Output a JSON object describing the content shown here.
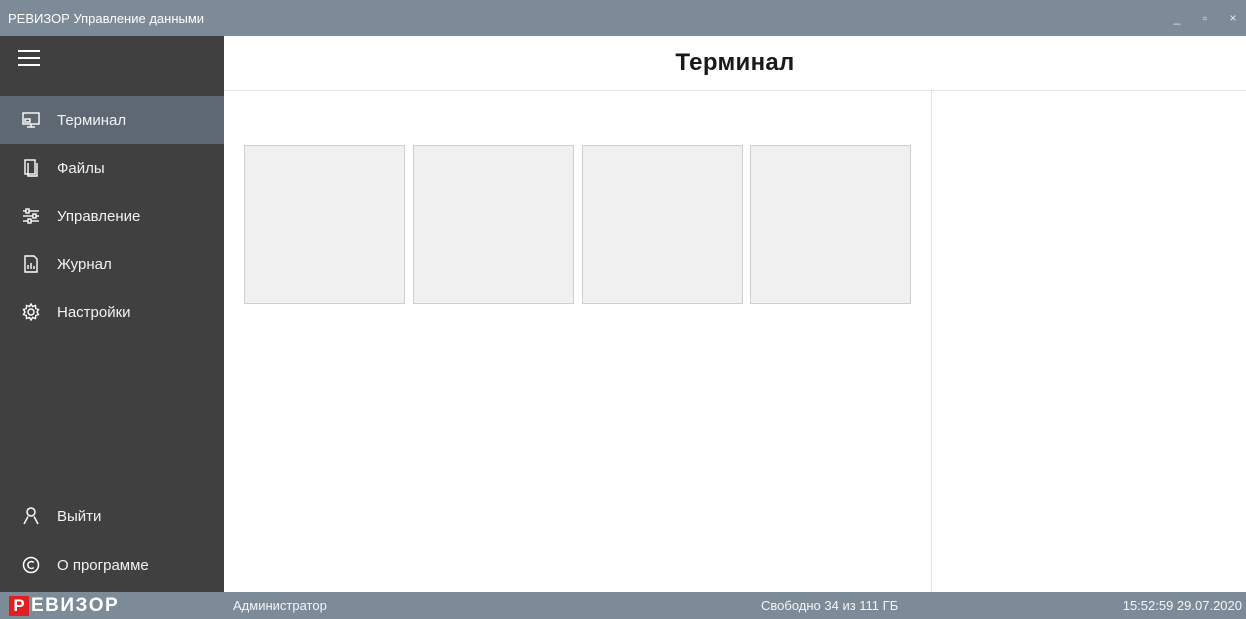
{
  "window": {
    "title": "РЕВИЗОР Управление данными",
    "controls": {
      "minimize": "_",
      "maximize": "▫",
      "close": "×"
    }
  },
  "sidebar": {
    "menu_icon": "hamburger-icon",
    "items": [
      {
        "label": "Терминал",
        "icon": "monitor-icon",
        "active": true
      },
      {
        "label": "Файлы",
        "icon": "files-icon",
        "active": false
      },
      {
        "label": "Управление",
        "icon": "sliders-icon",
        "active": false
      },
      {
        "label": "Журнал",
        "icon": "log-icon",
        "active": false
      },
      {
        "label": "Настройки",
        "icon": "gear-icon",
        "active": false
      }
    ],
    "bottom_items": [
      {
        "label": "Выйти",
        "icon": "user-icon"
      },
      {
        "label": "О программе",
        "icon": "copyright-icon"
      }
    ]
  },
  "header": {
    "title": "Терминал"
  },
  "main": {
    "tiles": [
      "",
      "",
      "",
      ""
    ]
  },
  "statusbar": {
    "logo_first": "Р",
    "logo_rest": "ЕВИЗОР",
    "user": "Администратор",
    "free_space": "Свободно 34 из 111 ГБ",
    "datetime": "15:52:59 29.07.2020"
  },
  "colors": {
    "titlebar": "#7d8a97",
    "sidebar": "#404040",
    "sidebar_active": "#5e6872",
    "logo_red": "#e02020",
    "tile_bg": "#f0f0f0"
  }
}
